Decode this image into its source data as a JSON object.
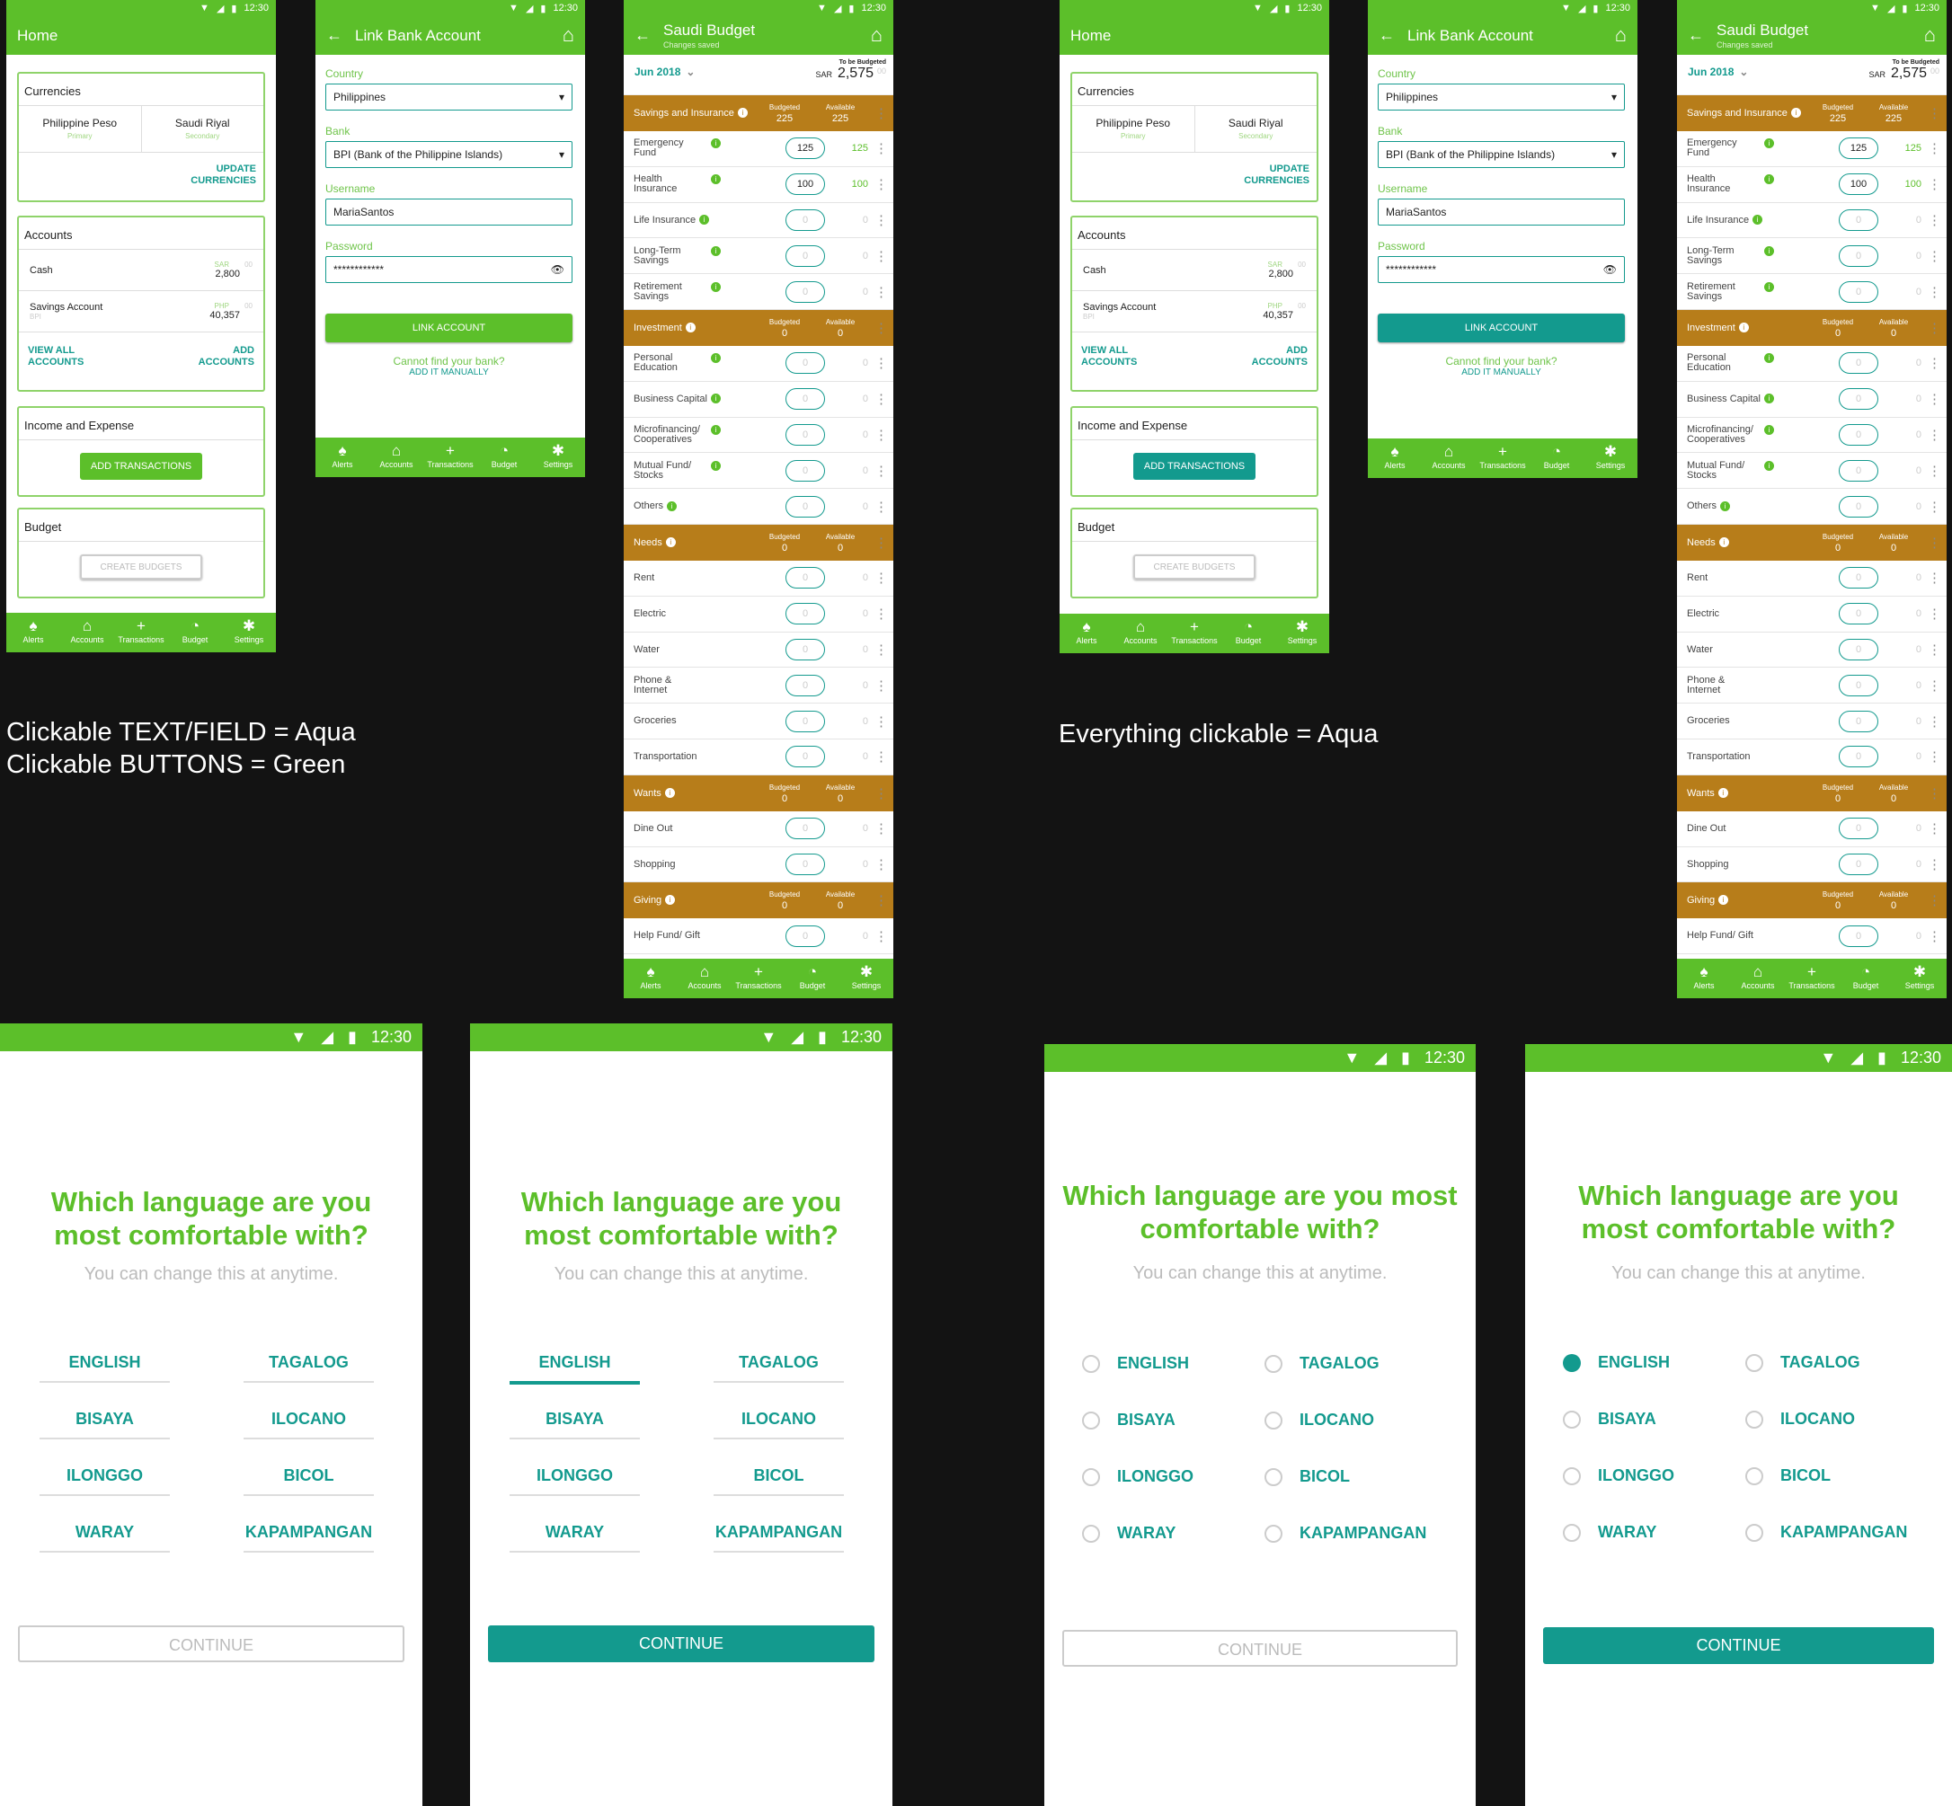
{
  "status_time": "12:30",
  "nav": [
    "Alerts",
    "Accounts",
    "Transactions",
    "Budget",
    "Settings"
  ],
  "home": {
    "title": "Home",
    "currencies": {
      "title": "Currencies",
      "primary": {
        "name": "Philippine Peso",
        "tag": "Primary"
      },
      "secondary": {
        "name": "Saudi Riyal",
        "tag": "Secondary"
      },
      "update": "UPDATE CURRENCIES"
    },
    "accounts": {
      "title": "Accounts",
      "items": [
        {
          "name": "Cash",
          "sub": "",
          "cur": "SAR",
          "amount": "2,800",
          "dec": "00"
        },
        {
          "name": "Savings Account",
          "sub": "BPI",
          "cur": "PHP",
          "amount": "40,357",
          "dec": "00"
        }
      ],
      "view_all": "VIEW ALL ACCOUNTS",
      "add": "ADD ACCOUNTS"
    },
    "income": {
      "title": "Income and Expense",
      "button": "ADD TRANSACTIONS"
    },
    "budget": {
      "title": "Budget",
      "button": "CREATE BUDGETS"
    }
  },
  "link": {
    "title": "Link Bank Account",
    "country_label": "Country",
    "country": "Philippines",
    "bank_label": "Bank",
    "bank": "BPI (Bank of the Philippine Islands)",
    "user_label": "Username",
    "user": "MariaSantos",
    "pass_label": "Password",
    "pass": "************",
    "button": "LINK ACCOUNT",
    "cannot": "Cannot find your bank?",
    "manual": "ADD IT MANUALLY"
  },
  "budget": {
    "title": "Saudi Budget",
    "subtitle": "Changes saved",
    "month": "Jun 2018",
    "tbb_label": "To be Budgeted",
    "tbb_cur": "SAR",
    "tbb": "2,575",
    "tbb_dec": "00",
    "budgeted_label": "Budgeted",
    "available_label": "Available",
    "groups": [
      {
        "name": "Savings and Insurance",
        "budgeted": "225",
        "available": "225",
        "items": [
          {
            "name": "Emergency Fund",
            "info": true,
            "b": "125",
            "a": "125",
            "v": true
          },
          {
            "name": "Health Insurance",
            "info": true,
            "b": "100",
            "a": "100",
            "v": true
          },
          {
            "name": "Life Insurance",
            "info": true,
            "b": "0",
            "a": "0"
          },
          {
            "name": "Long-Term Savings",
            "info": true,
            "b": "0",
            "a": "0"
          },
          {
            "name": "Retirement Savings",
            "info": true,
            "b": "0",
            "a": "0"
          }
        ]
      },
      {
        "name": "Investment",
        "budgeted": "0",
        "available": "0",
        "items": [
          {
            "name": "Personal Education",
            "info": true,
            "b": "0",
            "a": "0"
          },
          {
            "name": "Business Capital",
            "info": true,
            "b": "0",
            "a": "0"
          },
          {
            "name": "Microfinancing/ Cooperatives",
            "info": true,
            "b": "0",
            "a": "0"
          },
          {
            "name": "Mutual Fund/ Stocks",
            "info": true,
            "b": "0",
            "a": "0"
          },
          {
            "name": "Others",
            "info": true,
            "b": "0",
            "a": "0"
          }
        ]
      },
      {
        "name": "Needs",
        "budgeted": "0",
        "available": "0",
        "items": [
          {
            "name": "Rent",
            "b": "0",
            "a": "0"
          },
          {
            "name": "Electric",
            "b": "0",
            "a": "0"
          },
          {
            "name": "Water",
            "b": "0",
            "a": "0"
          },
          {
            "name": "Phone & Internet",
            "b": "0",
            "a": "0"
          },
          {
            "name": "Groceries",
            "b": "0",
            "a": "0"
          },
          {
            "name": "Transportation",
            "b": "0",
            "a": "0"
          }
        ]
      },
      {
        "name": "Wants",
        "budgeted": "0",
        "available": "0",
        "items": [
          {
            "name": "Dine Out",
            "b": "0",
            "a": "0"
          },
          {
            "name": "Shopping",
            "b": "0",
            "a": "0"
          }
        ]
      },
      {
        "name": "Giving",
        "budgeted": "0",
        "available": "0",
        "items": [
          {
            "name": "Help Fund/ Gift",
            "b": "0",
            "a": "0"
          }
        ]
      }
    ]
  },
  "notes": {
    "left1": "Clickable TEXT/FIELD = Aqua",
    "left2": "Clickable BUTTONS = Green",
    "right": "Everything clickable = Aqua"
  },
  "language": {
    "title": "Which language are you most comfortable with?",
    "subtitle": "You can change this at anytime.",
    "options": [
      "ENGLISH",
      "TAGALOG",
      "BISAYA",
      "ILOCANO",
      "ILONGGO",
      "BICOL",
      "WARAY",
      "KAPAMPANGAN"
    ],
    "continue": "CONTINUE"
  }
}
